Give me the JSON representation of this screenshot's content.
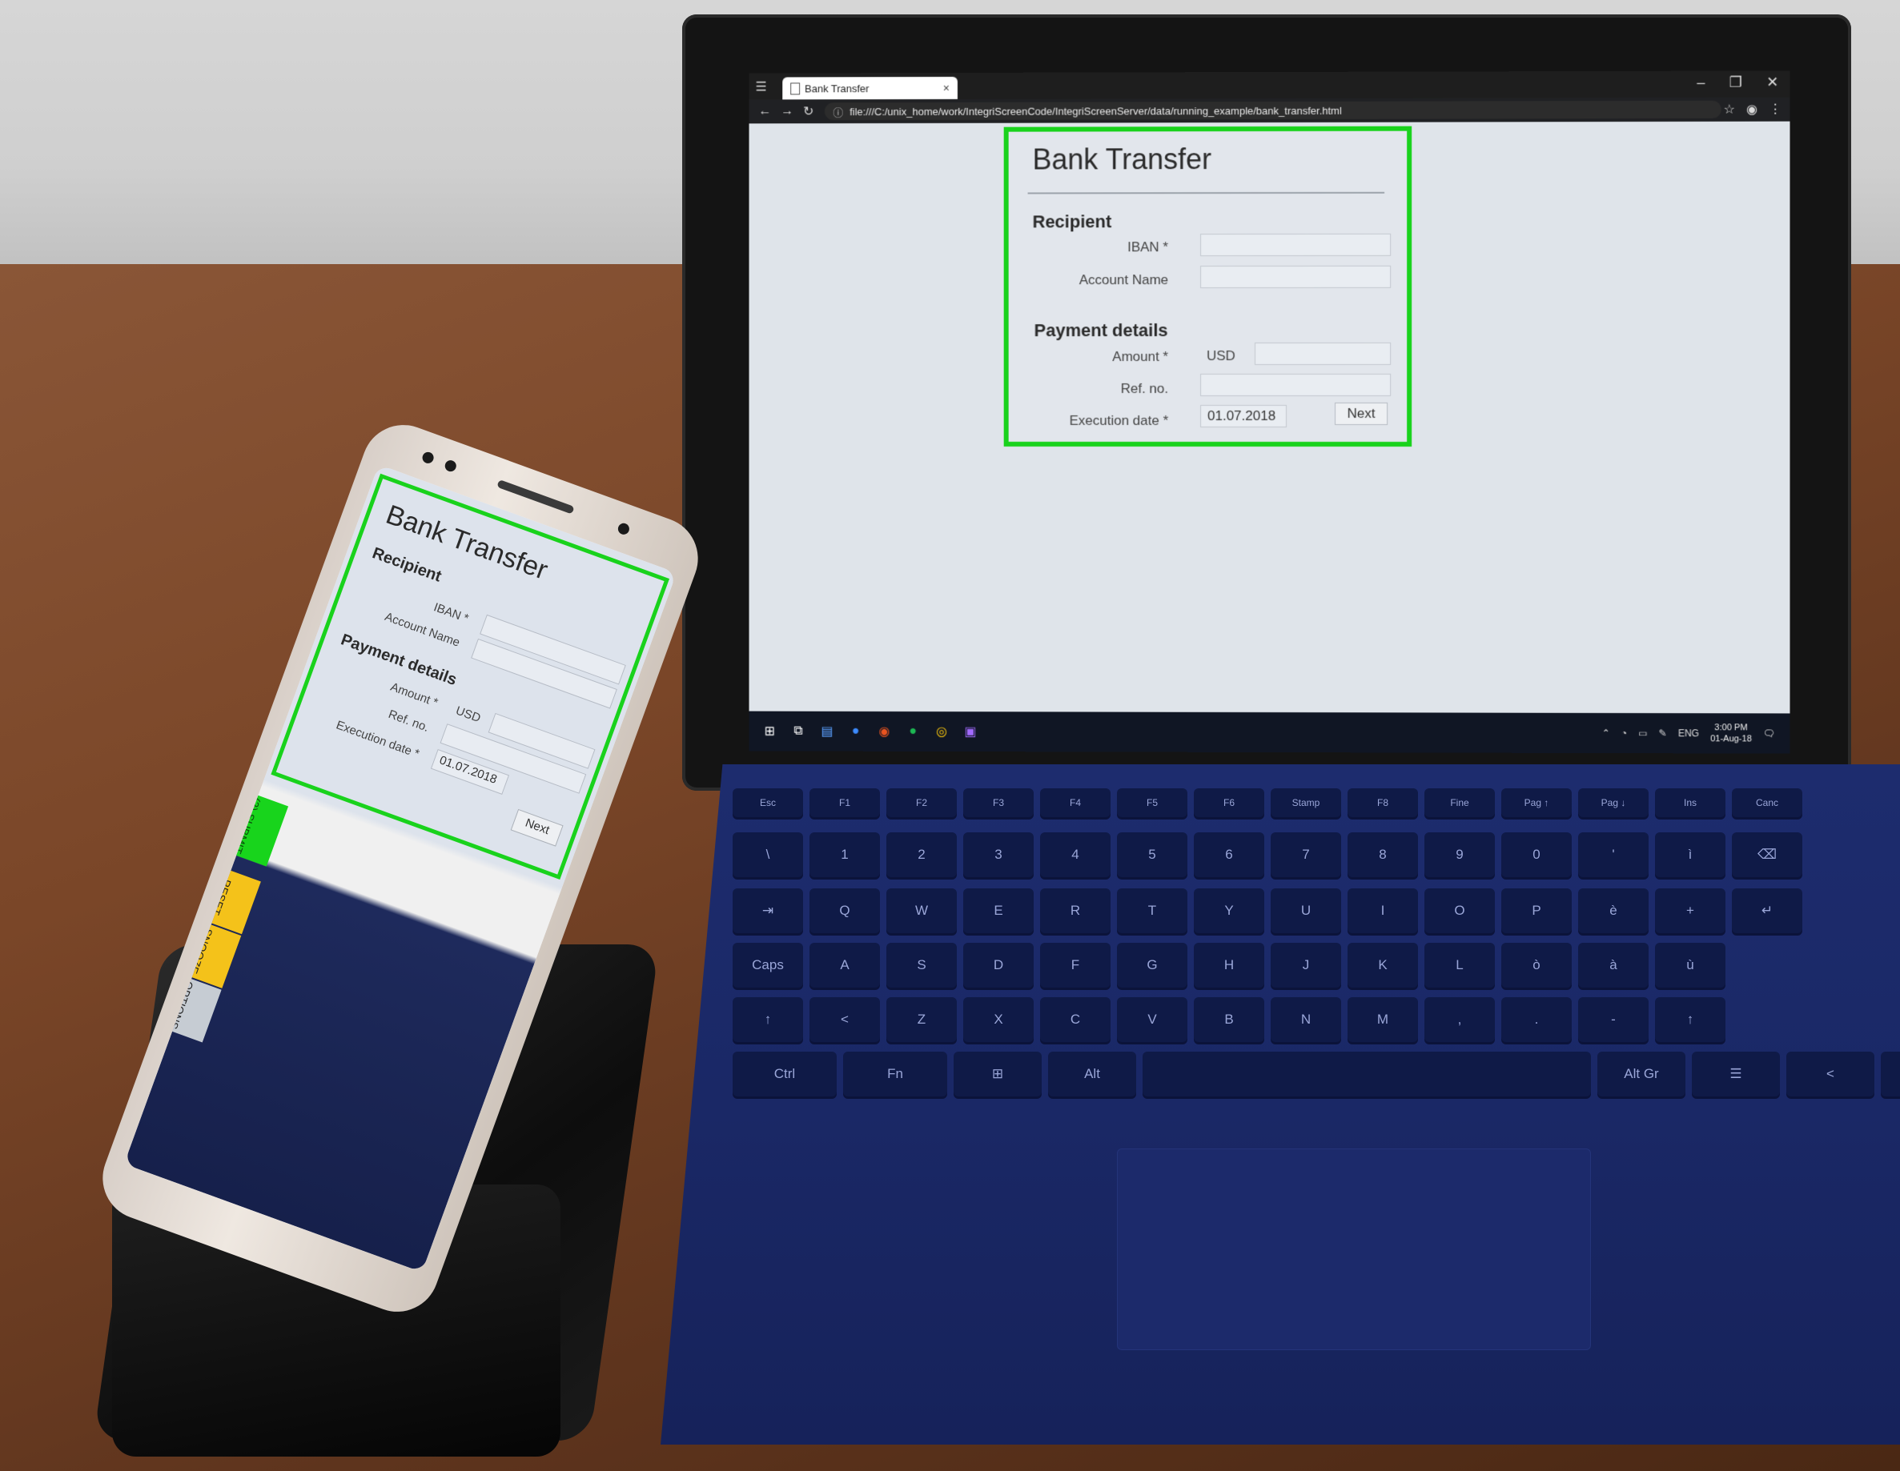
{
  "browser": {
    "tab_title": "Bank Transfer",
    "tab_close": "×",
    "url": "file:///C:/unix_home/work/IntegriScreenCode/IntegriScreenServer/data/running_example/bank_transfer.html"
  },
  "form": {
    "title": "Bank Transfer",
    "recipient_section": "Recipient",
    "iban_label": "IBAN *",
    "account_name_label": "Account Name",
    "payment_section": "Payment details",
    "amount_label": "Amount *",
    "currency": "USD",
    "ref_label": "Ref. no.",
    "execution_date_label": "Execution date *",
    "execution_date_value": "01.07.2018",
    "next_label": "Next",
    "frame_color": "#19d21c"
  },
  "taskbar": {
    "lang": "ENG",
    "time": "3:00 PM",
    "date": "01-Aug-18"
  },
  "phone": {
    "title": "Bank Transfer",
    "recipient_section": "Recipient",
    "iban_label": "IBAN *",
    "account_name_label": "Account Name",
    "payment_section": "Payment details",
    "amount_label": "Amount *",
    "currency": "USD",
    "ref_label": "Ref. no.",
    "execution_date_label": "Execution date *",
    "execution_date_value": "01.07.2018",
    "next_label": "Next",
    "submit_label": "(2) SUBMIT",
    "reset_label": "RESET",
    "snooze_label": "SNOOZE",
    "options_label": "OPTIONS"
  },
  "keyboard": {
    "row1": [
      "Esc",
      "F1",
      "F2",
      "F3",
      "F4",
      "F5",
      "F6",
      "Stamp",
      "F8",
      "Fine",
      "Pag ↑",
      "Pag ↓",
      "Ins",
      "Canc"
    ],
    "row2": [
      "\\",
      "1",
      "2",
      "3",
      "4",
      "5",
      "6",
      "7",
      "8",
      "9",
      "0",
      "'",
      "ì",
      "⌫"
    ],
    "row3": [
      "⇥",
      "Q",
      "W",
      "E",
      "R",
      "T",
      "Y",
      "U",
      "I",
      "O",
      "P",
      "è",
      "+",
      "↵"
    ],
    "row4": [
      "Caps",
      "A",
      "S",
      "D",
      "F",
      "G",
      "H",
      "J",
      "K",
      "L",
      "ò",
      "à",
      "ù"
    ],
    "row5": [
      "↑",
      "<",
      "Z",
      "X",
      "C",
      "V",
      "B",
      "N",
      "M",
      ",",
      ".",
      "-",
      "↑"
    ],
    "row6": [
      "Ctrl",
      "Fn",
      "⊞",
      "Alt",
      "",
      "Alt Gr",
      "☰",
      "<",
      "⌄"
    ]
  }
}
